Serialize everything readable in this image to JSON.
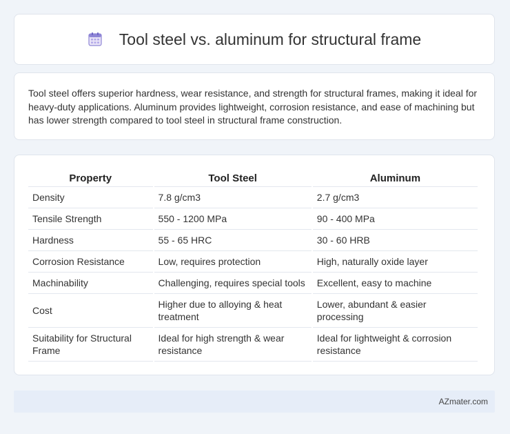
{
  "header": {
    "icon": "calendar-icon",
    "title": "Tool steel vs. aluminum for structural frame"
  },
  "summary": {
    "text": "Tool steel offers superior hardness, wear resistance, and strength for structural frames, making it ideal for heavy-duty applications. Aluminum provides lightweight, corrosion resistance, and ease of machining but has lower strength compared to tool steel in structural frame construction."
  },
  "table": {
    "headers": [
      "Property",
      "Tool Steel",
      "Aluminum"
    ],
    "rows": [
      [
        "Density",
        "7.8 g/cm3",
        "2.7 g/cm3"
      ],
      [
        "Tensile Strength",
        "550 - 1200 MPa",
        "90 - 400 MPa"
      ],
      [
        "Hardness",
        "55 - 65 HRC",
        "30 - 60 HRB"
      ],
      [
        "Corrosion Resistance",
        "Low, requires protection",
        "High, naturally oxide layer"
      ],
      [
        "Machinability",
        "Challenging, requires special tools",
        "Excellent, easy to machine"
      ],
      [
        "Cost",
        "Higher due to alloying & heat treatment",
        "Lower, abundant & easier processing"
      ],
      [
        "Suitability for Structural Frame",
        "Ideal for high strength & wear resistance",
        "Ideal for lightweight & corrosion resistance"
      ]
    ]
  },
  "footer": {
    "text": "AZmater.com"
  },
  "colors": {
    "background": "#f0f4f9",
    "card": "#ffffff",
    "footer": "#e6edf8",
    "text": "#333333"
  }
}
